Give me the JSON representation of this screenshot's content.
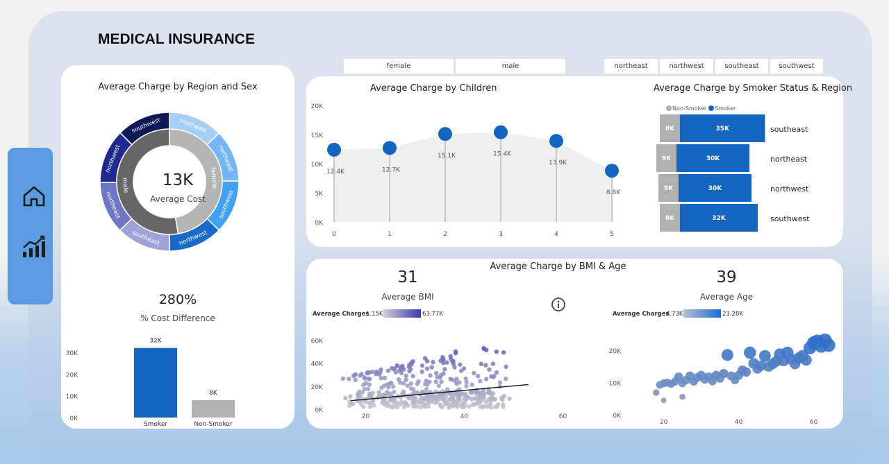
{
  "page_title": "MEDICAL INSURANCE",
  "nav": {
    "items": [
      {
        "icon": "home-icon"
      },
      {
        "icon": "bar-chart-icon"
      }
    ]
  },
  "slicers": {
    "sex": [
      "female",
      "male"
    ],
    "region": [
      "northeast",
      "northwest",
      "southeast",
      "southwest"
    ]
  },
  "colors": {
    "accent": "#1565c0",
    "gray": "#b0b0b0",
    "dark_gray": "#666666",
    "navbar": "#5b9be0"
  },
  "donut": {
    "title": "Average Charge by Region and Sex",
    "center_value": "13K",
    "center_label": "Average Cost",
    "inner": [
      {
        "label": "female",
        "value": 12.57,
        "color": "#b4b4b4"
      },
      {
        "label": "male",
        "value": 13.96,
        "color": "#666666"
      }
    ],
    "outer": [
      {
        "label": "southeast",
        "value": 13.5,
        "color": "#a5cff8"
      },
      {
        "label": "northeast",
        "value": 13.0,
        "color": "#75b6f7"
      },
      {
        "label": "southwest",
        "value": 13.4,
        "color": "#42a0f5"
      },
      {
        "label": "northwest",
        "value": 13.5,
        "color": "#1a6bc9"
      },
      {
        "label": "southeast",
        "value": 13.5,
        "color": "#a0a3da"
      },
      {
        "label": "northeast",
        "value": 13.0,
        "color": "#6f76c4"
      },
      {
        "label": "northwest",
        "value": 13.5,
        "color": "#212a8c"
      },
      {
        "label": "southwest",
        "value": 13.4,
        "color": "#0c1858"
      }
    ]
  },
  "cost_difference": {
    "value": "280%",
    "label": "% Cost Difference"
  },
  "smoker_bar": {
    "chart_data": {
      "type": "bar",
      "categories": [
        "Smoker",
        "Non-Smoker"
      ],
      "values": [
        32,
        8
      ],
      "data_labels": [
        "32K",
        "8K"
      ],
      "ytick_labels": [
        "0K",
        "10K",
        "20K",
        "30K"
      ],
      "ylim": [
        0,
        35
      ],
      "colors": [
        "#1565c0",
        "#b0b0b0"
      ]
    }
  },
  "children_chart": {
    "title": "Average Charge by Children",
    "chart_data": {
      "type": "line",
      "x": [
        0,
        1,
        2,
        3,
        4,
        5
      ],
      "values": [
        12.4,
        12.7,
        15.1,
        15.4,
        13.9,
        8.8
      ],
      "data_labels": [
        "12.4K",
        "12.7K",
        "15.1K",
        "15.4K",
        "13.9K",
        "8.8K"
      ],
      "ytick_labels": [
        "0K",
        "5K",
        "10K",
        "15K",
        "20K"
      ],
      "ylim": [
        0,
        20
      ]
    }
  },
  "smoker_region_chart": {
    "title": "Average Charge by Smoker Status & Region",
    "legend": [
      "Non-Smoker",
      "Smoker"
    ],
    "chart_data": {
      "type": "bar",
      "categories": [
        "southeast",
        "northeast",
        "northwest",
        "southwest"
      ],
      "series": [
        {
          "name": "Non-Smoker",
          "values": [
            8,
            9,
            9,
            8
          ],
          "labels": [
            "8K",
            "9K",
            "9K",
            "8K"
          ]
        },
        {
          "name": "Smoker",
          "values": [
            35,
            30,
            30,
            32
          ],
          "labels": [
            "35K",
            "30K",
            "30K",
            "32K"
          ]
        }
      ]
    }
  },
  "bmi_age": {
    "title": "Average Charge by BMI & Age",
    "bmi_kpi": {
      "value": "31",
      "label": "Average BMI"
    },
    "age_kpi": {
      "value": "39",
      "label": "Average Age"
    },
    "info_icon": "info-icon",
    "bmi_scatter": {
      "legend_title": "Average Charges",
      "legend_min": "1.15K",
      "legend_max": "63.77K",
      "xtick_labels": [
        "20",
        "40",
        "60"
      ],
      "ytick_labels": [
        "0K",
        "20K",
        "40K",
        "60K"
      ],
      "chart_data": {
        "type": "scatter",
        "xlim": [
          15,
          65
        ],
        "ylim": [
          0,
          65
        ],
        "trend": [
          [
            17,
            8
          ],
          [
            53,
            22
          ]
        ]
      }
    },
    "age_scatter": {
      "legend_title": "Average Charges",
      "legend_min": "4.73K",
      "legend_max": "23.28K",
      "xtick_labels": [
        "20",
        "40",
        "60"
      ],
      "ytick_labels": [
        "0K",
        "10K",
        "20K"
      ],
      "chart_data": {
        "type": "scatter",
        "xlim": [
          16,
          66
        ],
        "ylim": [
          0,
          25
        ],
        "points": [
          [
            18,
            7.1
          ],
          [
            19,
            9.5
          ],
          [
            20,
            4.7
          ],
          [
            20,
            10
          ],
          [
            21,
            10.2
          ],
          [
            22,
            9.8
          ],
          [
            23,
            10.5
          ],
          [
            24,
            12
          ],
          [
            25,
            10
          ],
          [
            25,
            5.8
          ],
          [
            26,
            11
          ],
          [
            27,
            12.3
          ],
          [
            28,
            10.5
          ],
          [
            29,
            11.8
          ],
          [
            30,
            12.5
          ],
          [
            31,
            11.2
          ],
          [
            32,
            12
          ],
          [
            33,
            10.6
          ],
          [
            34,
            12.5
          ],
          [
            35,
            11.5
          ],
          [
            36,
            13
          ],
          [
            37,
            18.8
          ],
          [
            38,
            12.3
          ],
          [
            39,
            11
          ],
          [
            40,
            12.5
          ],
          [
            41,
            14
          ],
          [
            42,
            13.5
          ],
          [
            43,
            19.5
          ],
          [
            44,
            16.2
          ],
          [
            45,
            14.5
          ],
          [
            46,
            15.5
          ],
          [
            47,
            18.5
          ],
          [
            48,
            15.2
          ],
          [
            49,
            16
          ],
          [
            50,
            16.8
          ],
          [
            51,
            19
          ],
          [
            52,
            17
          ],
          [
            53,
            19.5
          ],
          [
            54,
            17.5
          ],
          [
            55,
            16
          ],
          [
            56,
            17.8
          ],
          [
            57,
            18.5
          ],
          [
            58,
            17.2
          ],
          [
            59,
            21
          ],
          [
            60,
            22.5
          ],
          [
            61,
            23
          ],
          [
            62,
            21.5
          ],
          [
            63,
            23.3
          ],
          [
            64,
            21.8
          ]
        ]
      }
    }
  }
}
